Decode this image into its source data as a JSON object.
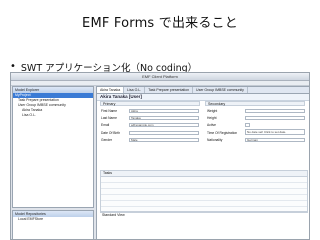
{
  "slide": {
    "title": "EMF Forms で出来ること",
    "bullet": "SWT アプリケーション化（No coding）"
  },
  "app": {
    "window_title": "EMF Client Platform"
  },
  "left_panel": {
    "header": "Model Explorer",
    "rows": [
      "MyProject",
      "Task Prepare presentation",
      "User Group IMBSE community",
      "Akira Tanaka",
      "Lisa O.L."
    ]
  },
  "left_bottom_panel": {
    "header": "Model Repositories",
    "rows": [
      "Local EMFStore"
    ]
  },
  "editor": {
    "tabs": [
      "Akira Tanaka",
      "Lisa O.L.",
      "Task Prepare presentation",
      "User Group IMBSE community"
    ],
    "heading": "Akira Tanaka [User]",
    "sections": {
      "primary": "Primary",
      "secondary": "Secondary"
    },
    "left_fields": [
      {
        "label": "First Name",
        "value": "Akira"
      },
      {
        "label": "Last Name",
        "value": "Tanaka"
      },
      {
        "label": "Email",
        "value": "a@example.com"
      },
      {
        "label": "Date Of Birth",
        "value": ""
      },
      {
        "label": "Gender",
        "value": "Male"
      }
    ],
    "right_fields": [
      {
        "label": "Weight",
        "value": ""
      },
      {
        "label": "Height",
        "value": ""
      },
      {
        "label": "Active",
        "value": ""
      },
      {
        "label": "Time Of Registration",
        "value": "No date set! Click to set date."
      },
      {
        "label": "Nationality",
        "value": "German"
      }
    ],
    "tasks_label": "Tasks",
    "standard_view": "Standard View"
  }
}
